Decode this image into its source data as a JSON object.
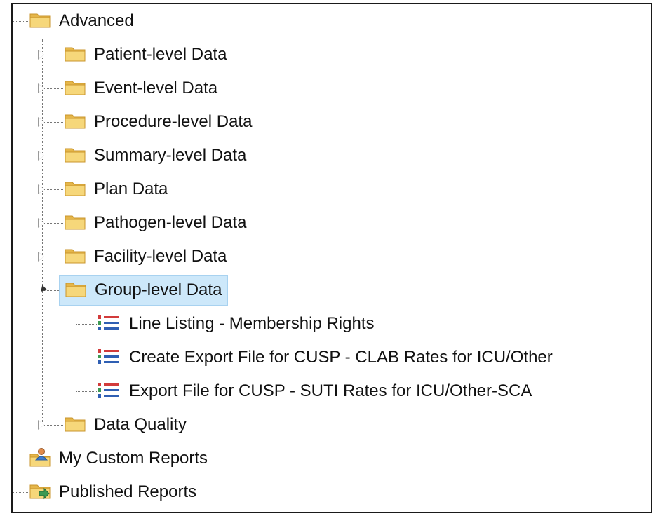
{
  "tree": {
    "root": {
      "label": "Advanced",
      "icon": "folder-icon"
    },
    "children": [
      {
        "label": "Patient-level Data",
        "icon": "folder-icon"
      },
      {
        "label": "Event-level Data",
        "icon": "folder-icon"
      },
      {
        "label": "Procedure-level Data",
        "icon": "folder-icon"
      },
      {
        "label": "Summary-level Data",
        "icon": "folder-icon"
      },
      {
        "label": "Plan Data",
        "icon": "folder-icon"
      },
      {
        "label": "Pathogen-level Data",
        "icon": "folder-icon"
      },
      {
        "label": "Facility-level Data",
        "icon": "folder-icon"
      },
      {
        "label": "Group-level Data",
        "icon": "folder-icon",
        "selected": true,
        "reports": [
          {
            "label": "Line Listing - Membership Rights",
            "icon": "report-list-icon"
          },
          {
            "label": "Create Export File for CUSP - CLAB Rates for ICU/Other",
            "icon": "report-list-icon"
          },
          {
            "label": "Export File for CUSP - SUTI Rates for ICU/Other-SCA",
            "icon": "report-list-icon"
          }
        ]
      },
      {
        "label": "Data Quality",
        "icon": "folder-icon"
      }
    ],
    "siblings": [
      {
        "label": "My Custom Reports",
        "icon": "user-folder-icon"
      },
      {
        "label": "Published Reports",
        "icon": "published-folder-icon"
      }
    ]
  },
  "colors": {
    "selected_bg": "#cde8fa",
    "folder": "#f2c75c",
    "list_red": "#d23b3b",
    "list_green": "#3c9a52",
    "list_blue": "#2f5fb3"
  }
}
